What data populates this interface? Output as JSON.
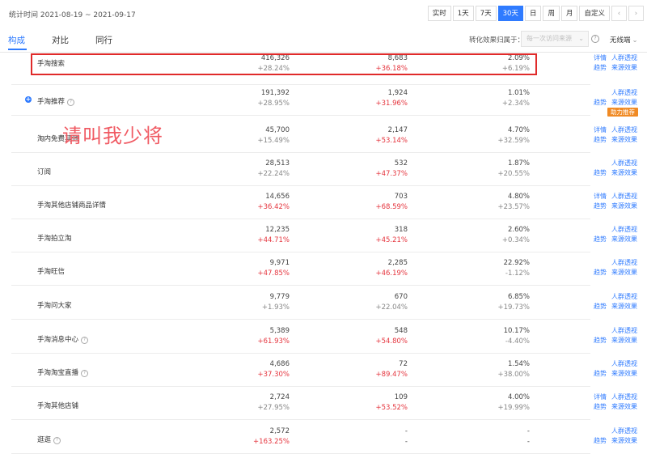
{
  "header": {
    "period": "统计时间 2021-08-19 ~ 2021-09-17",
    "buttons": [
      "实时",
      "1天",
      "7天",
      "30天",
      "日",
      "周",
      "月",
      "自定义"
    ],
    "active_button": "30天",
    "prev_icon": "chevron-left-icon",
    "next_icon": "chevron-right-icon"
  },
  "tabs": [
    "构成",
    "对比",
    "同行"
  ],
  "active_tab": "构成",
  "conversion": {
    "label": "转化效果归属于：",
    "select_value": "每一次访问来源",
    "wireless_label": "无线端"
  },
  "colors": {
    "accent": "#2f7bff",
    "up": "#e5353e",
    "down": "#888888",
    "highlight": "#e02a2a",
    "overlay": "#f05a63",
    "badge": "#f08a24"
  },
  "overlay_text": "请叫我少将",
  "rows": [
    {
      "name": "手淘搜索",
      "v1": "416,326",
      "c1": "+28.24%",
      "v2": "8,683",
      "c2": "+36.18%",
      "v3": "2.09%",
      "c3": "+6.19%",
      "links": [
        "详情",
        "人群透视",
        "趋势",
        "来源效果"
      ],
      "expand": false,
      "help": false
    },
    {
      "name": "手淘推荐",
      "v1": "191,392",
      "c1": "+28.95%",
      "v2": "1,924",
      "c2": "+31.96%",
      "v3": "1.01%",
      "c3": "+2.34%",
      "links": [
        "人群透视",
        "趋势",
        "来源效果"
      ],
      "expand": true,
      "help": true,
      "badge": "助力推荐"
    },
    {
      "name": "淘内免费其他",
      "v1": "45,700",
      "c1": "+15.49%",
      "v2": "2,147",
      "c2": "+53.14%",
      "v3": "4.70%",
      "c3": "+32.59%",
      "links": [
        "详情",
        "人群透视",
        "趋势",
        "来源效果"
      ],
      "expand": false,
      "help": false
    },
    {
      "name": "订阅",
      "v1": "28,513",
      "c1": "+22.24%",
      "v2": "532",
      "c2": "+47.37%",
      "v3": "1.87%",
      "c3": "+20.55%",
      "links": [
        "人群透视",
        "趋势",
        "来源效果"
      ],
      "expand": false,
      "help": false
    },
    {
      "name": "手淘其他店铺商品详情",
      "v1": "14,656",
      "c1": "+36.42%",
      "v2": "703",
      "c2": "+68.59%",
      "v3": "4.80%",
      "c3": "+23.57%",
      "links": [
        "详情",
        "人群透视",
        "趋势",
        "来源效果"
      ],
      "expand": false,
      "help": false
    },
    {
      "name": "手淘拍立淘",
      "v1": "12,235",
      "c1": "+44.71%",
      "v2": "318",
      "c2": "+45.21%",
      "v3": "2.60%",
      "c3": "+0.34%",
      "links": [
        "人群透视",
        "趋势",
        "来源效果"
      ],
      "expand": false,
      "help": false
    },
    {
      "name": "手淘旺信",
      "v1": "9,971",
      "c1": "+47.85%",
      "v2": "2,285",
      "c2": "+46.19%",
      "v3": "22.92%",
      "c3": "-1.12%",
      "links": [
        "人群透视",
        "趋势",
        "来源效果"
      ],
      "expand": false,
      "help": false
    },
    {
      "name": "手淘问大家",
      "v1": "9,779",
      "c1": "+1.93%",
      "v2": "670",
      "c2": "+22.04%",
      "v3": "6.85%",
      "c3": "+19.73%",
      "links": [
        "人群透视",
        "趋势",
        "来源效果"
      ],
      "expand": false,
      "help": false
    },
    {
      "name": "手淘消息中心",
      "v1": "5,389",
      "c1": "+61.93%",
      "v2": "548",
      "c2": "+54.80%",
      "v3": "10.17%",
      "c3": "-4.40%",
      "links": [
        "人群透视",
        "趋势",
        "来源效果"
      ],
      "expand": false,
      "help": true
    },
    {
      "name": "手淘淘宝直播",
      "v1": "4,686",
      "c1": "+37.30%",
      "v2": "72",
      "c2": "+89.47%",
      "v3": "1.54%",
      "c3": "+38.00%",
      "links": [
        "人群透视",
        "趋势",
        "来源效果"
      ],
      "expand": false,
      "help": true
    },
    {
      "name": "手淘其他店铺",
      "v1": "2,724",
      "c1": "+27.95%",
      "v2": "109",
      "c2": "+53.52%",
      "v3": "4.00%",
      "c3": "+19.99%",
      "links": [
        "详情",
        "人群透视",
        "趋势",
        "来源效果"
      ],
      "expand": false,
      "help": false
    },
    {
      "name": "逛逛",
      "v1": "2,572",
      "c1": "+163.25%",
      "v2": "-",
      "c2": "-",
      "v3": "-",
      "c3": "-",
      "links": [
        "人群透视",
        "趋势",
        "来源效果"
      ],
      "expand": false,
      "help": true
    }
  ]
}
